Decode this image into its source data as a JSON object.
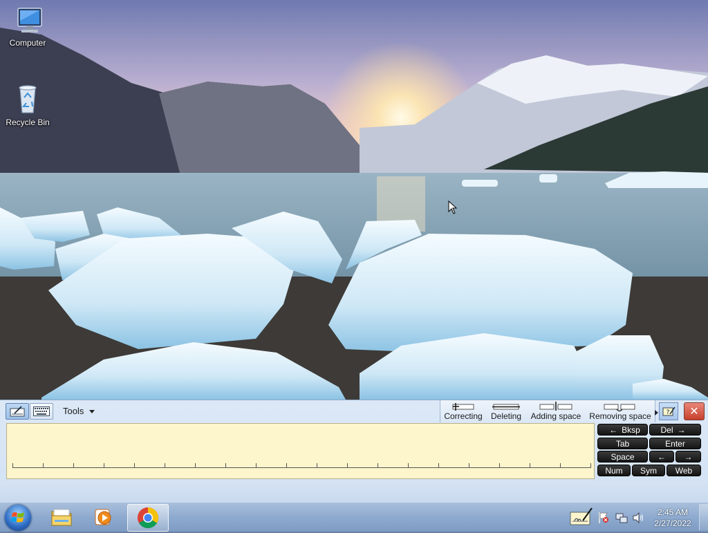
{
  "desktop": {
    "icons": [
      {
        "label": "Computer",
        "icon": "computer-icon"
      },
      {
        "label": "Recycle Bin",
        "icon": "recycle-bin-icon"
      }
    ]
  },
  "input_panel": {
    "tools_label": "Tools",
    "gestures": {
      "correcting": "Correcting",
      "deleting": "Deleting",
      "adding_space": "Adding space",
      "removing_space": "Removing space"
    },
    "help_icon": "help-icon",
    "close_icon": "close-icon",
    "keys": {
      "bksp": "Bksp",
      "del": "Del",
      "tab": "Tab",
      "enter": "Enter",
      "space": "Space",
      "num": "Num",
      "sym": "Sym",
      "web": "Web",
      "left_arrow": "←",
      "right_arrow": "→"
    }
  },
  "taskbar": {
    "pinned": [
      {
        "name": "windows-explorer",
        "icon": "folder-icon"
      },
      {
        "name": "media-player",
        "icon": "media-player-icon"
      },
      {
        "name": "google-chrome",
        "icon": "chrome-icon",
        "active": true
      }
    ],
    "clock": {
      "time": "2:45 AM",
      "date": "2/27/2022"
    }
  },
  "colors": {
    "pad_background": "#fdf5cc",
    "panel_background": "#dce8f6",
    "close_button": "#c7402c",
    "taskbar": "#8eaacf"
  }
}
